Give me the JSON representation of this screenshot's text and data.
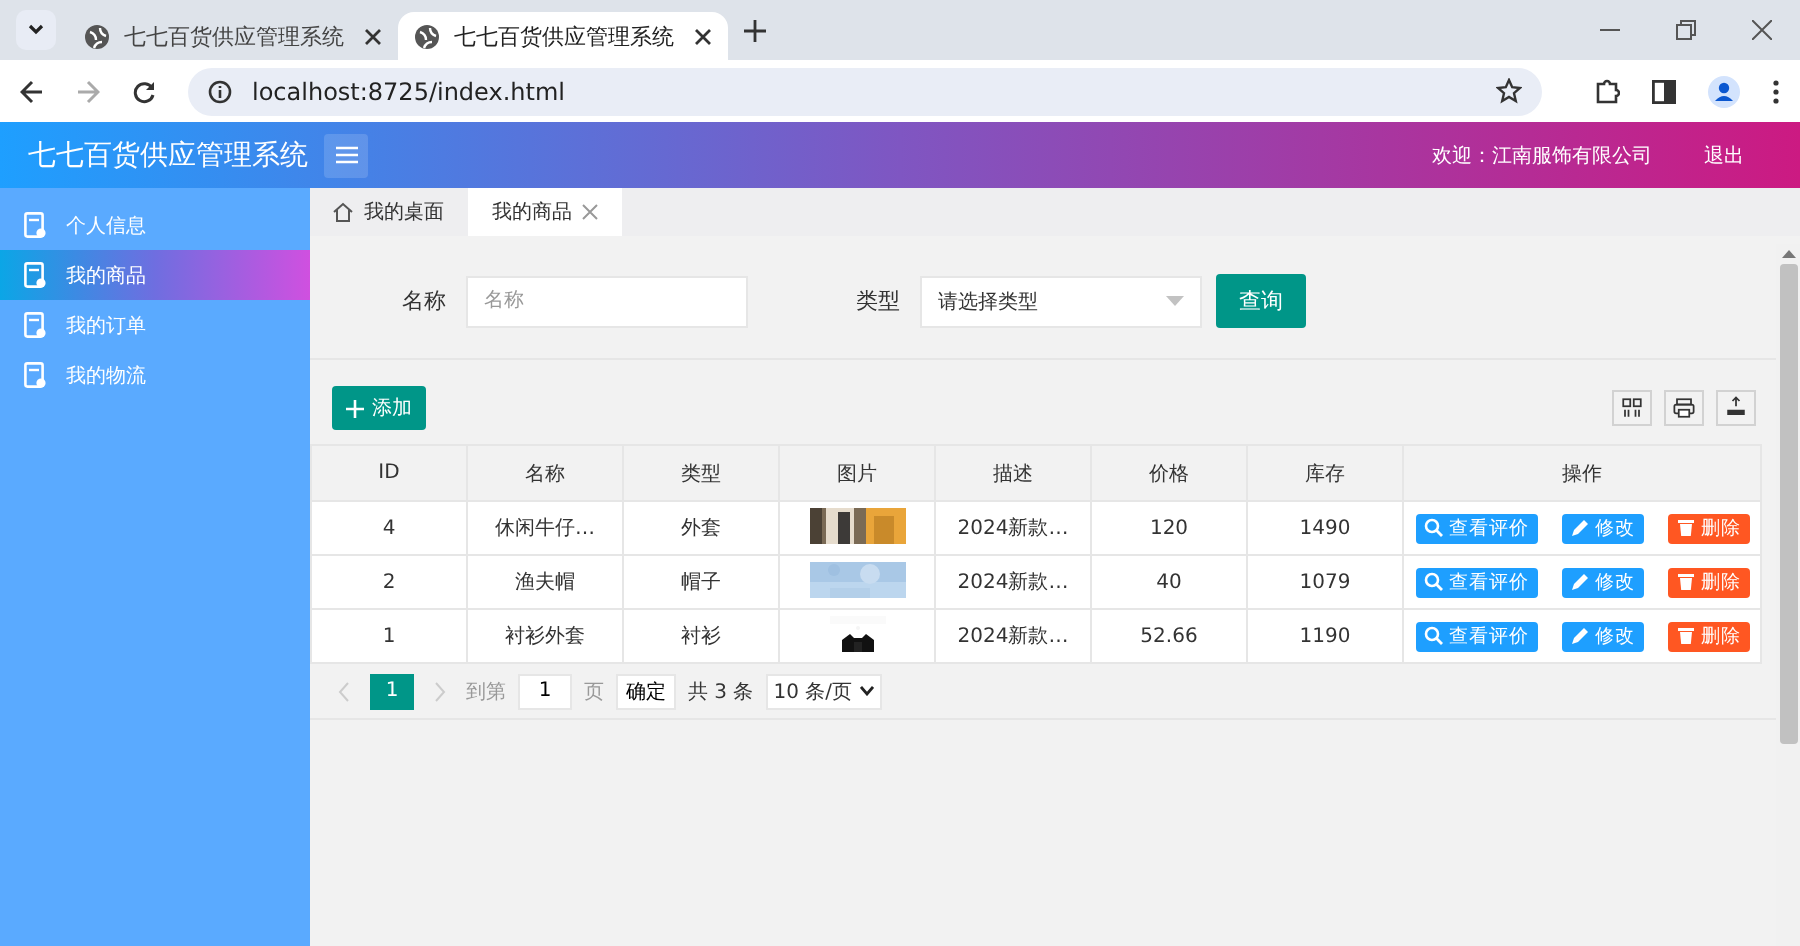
{
  "browser": {
    "tabs": [
      {
        "title": "七七百货供应管理系统",
        "selected": false
      },
      {
        "title": "七七百货供应管理系统",
        "selected": true
      }
    ],
    "address": "localhost:8725/index.html"
  },
  "header": {
    "title": "七七百货供应管理系统",
    "welcome": "欢迎：江南服饰有限公司",
    "logout": "退出"
  },
  "sidebar": {
    "items": [
      {
        "label": "个人信息",
        "selected": false
      },
      {
        "label": "我的商品",
        "selected": true
      },
      {
        "label": "我的订单",
        "selected": false
      },
      {
        "label": "我的物流",
        "selected": false
      }
    ]
  },
  "page_tabs": [
    {
      "label": "我的桌面",
      "kind": "home",
      "selected": false
    },
    {
      "label": "我的商品",
      "kind": "closable",
      "selected": true
    }
  ],
  "search": {
    "name_label": "名称",
    "name_placeholder": "名称",
    "type_label": "类型",
    "type_value": "请选择类型",
    "query": "查询"
  },
  "add_button": "添加",
  "table": {
    "columns": [
      "ID",
      "名称",
      "类型",
      "图片",
      "描述",
      "价格",
      "库存",
      "操作"
    ],
    "rows": [
      {
        "cells": [
          "4",
          "休闲牛仔…",
          "外套"
        ],
        "desc": "2024新款…",
        "price": "120",
        "stock": "1490",
        "actions": [
          {
            "label": "查看评价",
            "kind": "view"
          },
          {
            "label": "修改",
            "kind": "edit"
          },
          {
            "label": "删除",
            "kind": "delete"
          }
        ]
      },
      {
        "cells": [
          "2",
          "渔夫帽",
          "帽子"
        ],
        "desc": "2024新款…",
        "price": "40",
        "stock": "1079",
        "actions": [
          {
            "label": "查看评价",
            "kind": "view"
          },
          {
            "label": "修改",
            "kind": "edit"
          },
          {
            "label": "删除",
            "kind": "delete"
          }
        ]
      },
      {
        "cells": [
          "1",
          "衬衫外套",
          "衬衫"
        ],
        "desc": "2024新款…",
        "price": "52.66",
        "stock": "1190",
        "actions": [
          {
            "label": "查看评价",
            "kind": "view"
          },
          {
            "label": "修改",
            "kind": "edit"
          },
          {
            "label": "删除",
            "kind": "delete"
          }
        ]
      }
    ]
  },
  "pagination": {
    "pages": [
      {
        "label": "1",
        "selected": true
      }
    ],
    "goto_label": "到第",
    "goto_value": "1",
    "page_unit": "页",
    "confirm": "确定",
    "total": "共 3 条",
    "page_size": "10 条/页"
  }
}
